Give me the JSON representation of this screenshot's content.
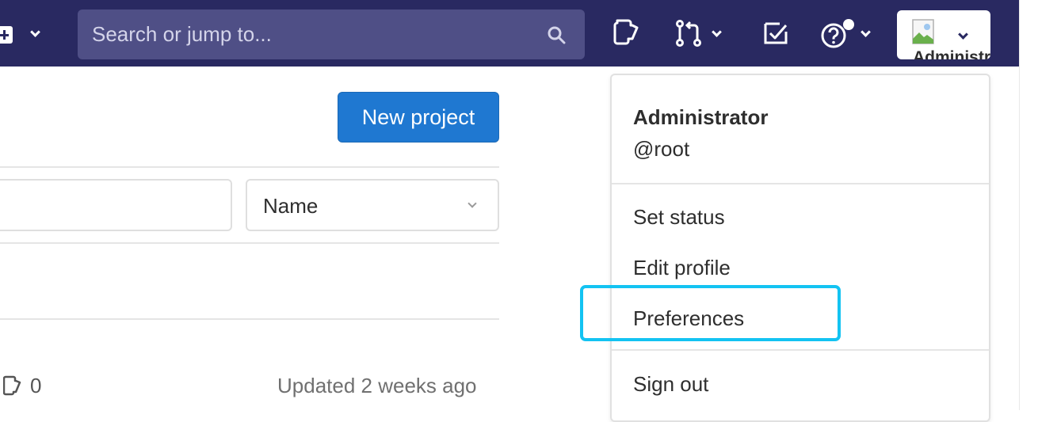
{
  "header": {
    "search_placeholder": "Search or jump to...",
    "avatar_alt": "Administrator"
  },
  "main": {
    "new_project_label": "New project",
    "sort_selected": "Name",
    "project": {
      "issues_count": "0",
      "updated_text": "Updated 2 weeks ago"
    }
  },
  "user_menu": {
    "name": "Administrator",
    "handle": "@root",
    "items": [
      "Set status",
      "Edit profile",
      "Preferences",
      "Sign out"
    ],
    "highlighted_item": "Preferences"
  },
  "colors": {
    "navbar": "#292961",
    "search_bg": "#4f4f86",
    "primary_button": "#1f78d1",
    "highlight": "#13c3f2"
  }
}
